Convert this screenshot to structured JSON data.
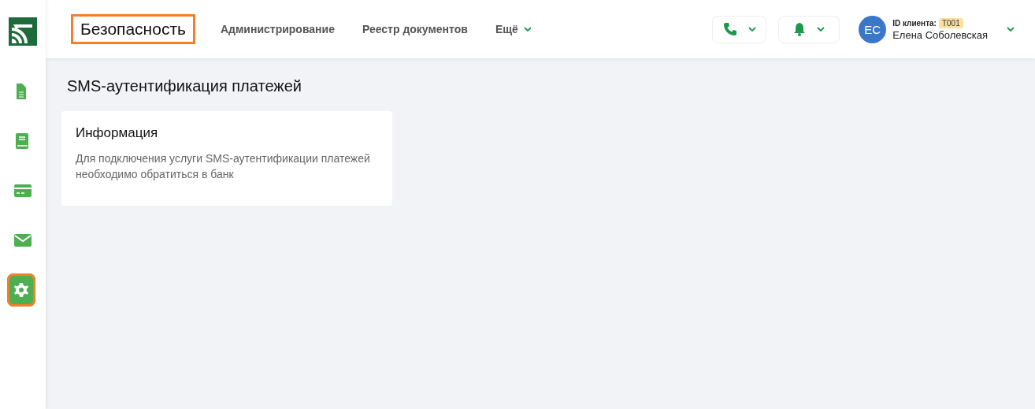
{
  "sidebar": {
    "items": [
      {
        "kind": "document",
        "selected": false,
        "highlighted": false
      },
      {
        "kind": "book",
        "selected": false,
        "highlighted": false
      },
      {
        "kind": "card",
        "selected": false,
        "highlighted": false
      },
      {
        "kind": "mail",
        "selected": false,
        "highlighted": false
      },
      {
        "kind": "settings",
        "selected": true,
        "highlighted": true
      }
    ]
  },
  "header": {
    "section_title": {
      "text": "Безопасность",
      "highlighted": true
    },
    "nav": [
      {
        "label": "Администрирование",
        "dropdown": false
      },
      {
        "label": "Реестр документов",
        "dropdown": false
      },
      {
        "label": "Ещё",
        "dropdown": true
      }
    ],
    "actions": [
      {
        "kind": "phone"
      },
      {
        "kind": "bell"
      }
    ],
    "user": {
      "initials": "ЕС",
      "id_label": "ID клиента:",
      "id_value": "T001",
      "name": "Елена Соболевская"
    }
  },
  "page": {
    "title": "SMS-аутентификация платежей",
    "card": {
      "title": "Информация",
      "text": "Для подключения услуги SMS-аутентификации платежей необходимо обратиться в банк"
    }
  }
}
